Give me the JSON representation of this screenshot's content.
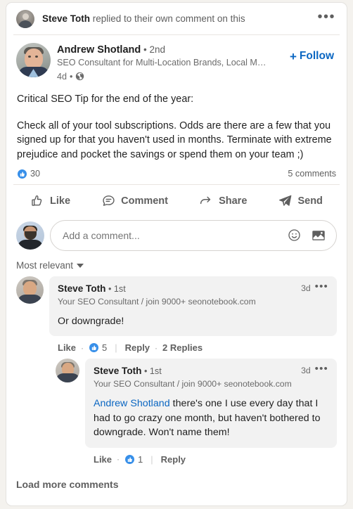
{
  "colors": {
    "brand_blue": "#0a66c2",
    "reaction_blue": "#378fe9",
    "page_bg": "#f4f2ee",
    "card_bg": "#ffffff",
    "bubble_bg": "#f2f2f2",
    "text_primary": "#1f1f1f",
    "text_secondary": "#5f5f5f"
  },
  "context": {
    "actor": "Steve Toth",
    "action": " replied to their own comment on this",
    "menu_icon": "ellipsis-icon",
    "avatar_icon": "actor-avatar"
  },
  "author": {
    "name": "Andrew Shotland",
    "separator": " • ",
    "degree": "2nd",
    "headline": "SEO Consultant for Multi-Location Brands, Local Marketpla...",
    "time": "4d",
    "meta_separator": "•",
    "visibility_icon": "globe-icon",
    "follow_plus": "+",
    "follow_label": "Follow"
  },
  "post": {
    "paragraphs": [
      "Critical SEO Tip for the end of the year:",
      "Check all of your tool subscriptions. Odds are there are a few that you signed up for that you haven't used in months. Terminate with extreme prejudice and pocket the savings or spend them on your team ;)"
    ],
    "reaction_icon": "like-reaction-icon",
    "reaction_count": "30",
    "comments_count": "5 comments"
  },
  "actions": [
    {
      "icon": "thumbs-up-icon",
      "label": "Like"
    },
    {
      "icon": "comment-bubble-icon",
      "label": "Comment"
    },
    {
      "icon": "share-arrow-icon",
      "label": "Share"
    },
    {
      "icon": "send-paper-plane-icon",
      "label": "Send"
    }
  ],
  "composer": {
    "avatar_icon": "current-user-avatar",
    "placeholder": "Add a comment...",
    "emoji_icon": "emoji-smiley-icon",
    "image_icon": "image-photo-icon"
  },
  "sort": {
    "label": "Most relevant",
    "caret_icon": "chevron-down-icon"
  },
  "comments": [
    {
      "avatar_icon": "commenter-avatar",
      "name": "Steve Toth",
      "separator": " • ",
      "degree": "1st",
      "headline": "Your SEO Consultant / join 9000+ seonotebook.com",
      "time": "3d",
      "menu_icon": "ellipsis-icon",
      "text": "Or downgrade!",
      "mention": "",
      "like_label": "Like",
      "reaction_icon": "like-reaction-icon",
      "reaction_count": "5",
      "reply_label": "Reply",
      "replies_label": "2 Replies",
      "nested": false
    },
    {
      "avatar_icon": "commenter-avatar",
      "name": "Steve Toth",
      "separator": " • ",
      "degree": "1st",
      "headline": "Your SEO Consultant / join 9000+ seonotebook.com",
      "time": "3d",
      "menu_icon": "ellipsis-icon",
      "mention": "Andrew Shotland",
      "text": " there's one I use every day that I had to go crazy one month, but haven't bothered to downgrade. Won't name them!",
      "like_label": "Like",
      "reaction_icon": "like-reaction-icon",
      "reaction_count": "1",
      "reply_label": "Reply",
      "replies_label": "",
      "nested": true
    }
  ],
  "load_more": {
    "label": "Load more comments"
  }
}
